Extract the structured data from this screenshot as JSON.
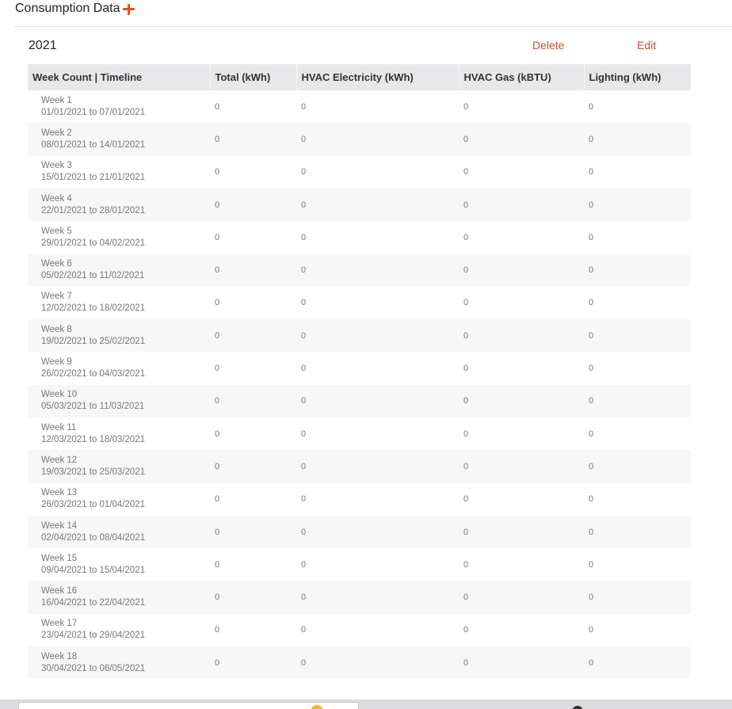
{
  "section": {
    "title": "Consumption Data",
    "add_icon": "plus-icon",
    "accent_color": "#e4541b"
  },
  "year_block": {
    "year": "2021",
    "delete_label": "Delete",
    "edit_label": "Edit",
    "link_color": "#c8502a"
  },
  "table": {
    "headers": [
      "Week Count | Timeline",
      "Total (kWh)",
      "HVAC Electricity (kWh)",
      "HVAC Gas (kBTU)",
      "Lighting (kWh)"
    ],
    "rows": [
      {
        "week": "Week 1",
        "range": "01/01/2021 to 07/01/2021",
        "total": "0",
        "hvac_elec": "0",
        "hvac_gas": "0",
        "lighting": "0"
      },
      {
        "week": "Week 2",
        "range": "08/01/2021 to 14/01/2021",
        "total": "0",
        "hvac_elec": "0",
        "hvac_gas": "0",
        "lighting": "0"
      },
      {
        "week": "Week 3",
        "range": "15/01/2021 to 21/01/2021",
        "total": "0",
        "hvac_elec": "0",
        "hvac_gas": "0",
        "lighting": "0"
      },
      {
        "week": "Week 4",
        "range": "22/01/2021 to 28/01/2021",
        "total": "0",
        "hvac_elec": "0",
        "hvac_gas": "0",
        "lighting": "0"
      },
      {
        "week": "Week 5",
        "range": "29/01/2021 to 04/02/2021",
        "total": "0",
        "hvac_elec": "0",
        "hvac_gas": "0",
        "lighting": "0"
      },
      {
        "week": "Week 6",
        "range": "05/02/2021 to 11/02/2021",
        "total": "0",
        "hvac_elec": "0",
        "hvac_gas": "0",
        "lighting": "0"
      },
      {
        "week": "Week 7",
        "range": "12/02/2021 to 18/02/2021",
        "total": "0",
        "hvac_elec": "0",
        "hvac_gas": "0",
        "lighting": "0"
      },
      {
        "week": "Week 8",
        "range": "19/02/2021 to 25/02/2021",
        "total": "0",
        "hvac_elec": "0",
        "hvac_gas": "0",
        "lighting": "0"
      },
      {
        "week": "Week 9",
        "range": "26/02/2021 to 04/03/2021",
        "total": "0",
        "hvac_elec": "0",
        "hvac_gas": "0",
        "lighting": "0"
      },
      {
        "week": "Week 10",
        "range": "05/03/2021 to 11/03/2021",
        "total": "0",
        "hvac_elec": "0",
        "hvac_gas": "0",
        "lighting": "0"
      },
      {
        "week": "Week 11",
        "range": "12/03/2021 to 18/03/2021",
        "total": "0",
        "hvac_elec": "0",
        "hvac_gas": "0",
        "lighting": "0"
      },
      {
        "week": "Week 12",
        "range": "19/03/2021 to 25/03/2021",
        "total": "0",
        "hvac_elec": "0",
        "hvac_gas": "0",
        "lighting": "0"
      },
      {
        "week": "Week 13",
        "range": "26/03/2021 to 01/04/2021",
        "total": "0",
        "hvac_elec": "0",
        "hvac_gas": "0",
        "lighting": "0"
      },
      {
        "week": "Week 14",
        "range": "02/04/2021 to 08/04/2021",
        "total": "0",
        "hvac_elec": "0",
        "hvac_gas": "0",
        "lighting": "0"
      },
      {
        "week": "Week 15",
        "range": "09/04/2021 to 15/04/2021",
        "total": "0",
        "hvac_elec": "0",
        "hvac_gas": "0",
        "lighting": "0"
      },
      {
        "week": "Week 16",
        "range": "16/04/2021 to 22/04/2021",
        "total": "0",
        "hvac_elec": "0",
        "hvac_gas": "0",
        "lighting": "0"
      },
      {
        "week": "Week 17",
        "range": "23/04/2021 to 29/04/2021",
        "total": "0",
        "hvac_elec": "0",
        "hvac_gas": "0",
        "lighting": "0"
      },
      {
        "week": "Week 18",
        "range": "30/04/2021 to 06/05/2021",
        "total": "0",
        "hvac_elec": "0",
        "hvac_gas": "0",
        "lighting": "0"
      }
    ]
  }
}
